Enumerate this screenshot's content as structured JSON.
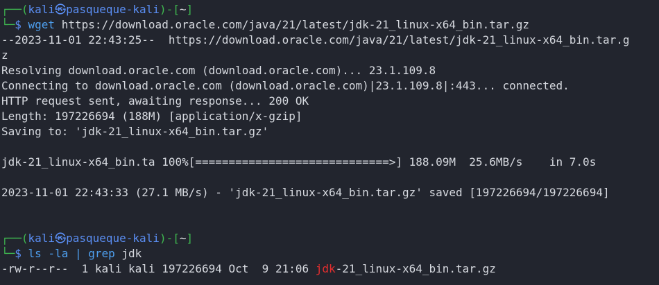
{
  "prompt1": {
    "l1_start": "┌──(",
    "user": "kali",
    "at": "㉿",
    "host": "pasqueque-kali",
    "mid": ")-[",
    "dir": "~",
    "end": "]",
    "l2_start": "└─",
    "dollar": "$ ",
    "command": "wget",
    "args": " https://download.oracle.com/java/21/latest/jdk-21_linux-x64_bin.tar.gz"
  },
  "output": [
    "--2023-11-01 22:43:25--  https://download.oracle.com/java/21/latest/jdk-21_linux-x64_bin.tar.g",
    "z",
    "Resolving download.oracle.com (download.oracle.com)... 23.1.109.8",
    "Connecting to download.oracle.com (download.oracle.com)|23.1.109.8|:443... connected.",
    "HTTP request sent, awaiting response... 200 OK",
    "Length: 197226694 (188M) [application/x-gzip]",
    "Saving to: 'jdk-21_linux-x64_bin.tar.gz'",
    "",
    "jdk-21_linux-x64_bin.ta 100%[=============================>] 188.09M  25.6MB/s    in 7.0s",
    "",
    "2023-11-01 22:43:33 (27.1 MB/s) - 'jdk-21_linux-x64_bin.tar.gz' saved [197226694/197226694]",
    "",
    ""
  ],
  "prompt2": {
    "l1_start": "┌──(",
    "user": "kali",
    "at": "㉿",
    "host": "pasqueque-kali",
    "mid": ")-[",
    "dir": "~",
    "end": "]",
    "l2_start": "└─",
    "dollar": "$ ",
    "cmd1": "ls",
    "opt": " -la",
    "pipe": " | ",
    "cmd2": "grep",
    "arg": " jdk"
  },
  "ls_result": {
    "prefix": "-rw-r--r--  1 kali kali 197226694 Oct  9 21:06 ",
    "match": "jdk",
    "suffix": "-21_linux-x64_bin.tar.gz"
  },
  "colors": {
    "background": "#22252e",
    "prompt_frame": "#3fb950",
    "prompt_host": "#5b8ff5",
    "command": "#4ea0f0",
    "grep_match": "#e52e2e"
  }
}
